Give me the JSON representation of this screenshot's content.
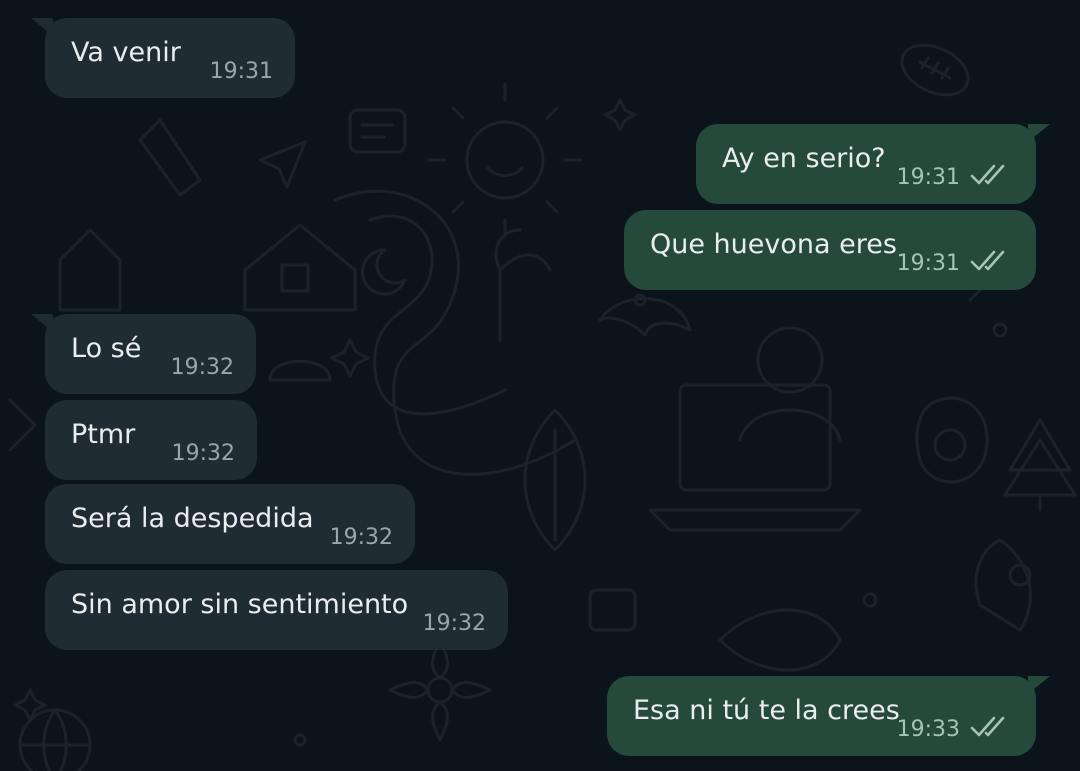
{
  "chat": {
    "messages": [
      {
        "direction": "in",
        "text": "Va venir",
        "time": "19:31",
        "status": "none"
      },
      {
        "direction": "out",
        "text": "Ay en serio?",
        "time": "19:31",
        "status": "read-double-check-icon"
      },
      {
        "direction": "out",
        "text": "Que huevona eres",
        "time": "19:31",
        "status": "read-double-check-icon"
      },
      {
        "direction": "in",
        "text": "Lo sé",
        "time": "19:32",
        "status": "none"
      },
      {
        "direction": "in",
        "text": "Ptmr",
        "time": "19:32",
        "status": "none"
      },
      {
        "direction": "in",
        "text": "Será la despedida",
        "time": "19:32",
        "status": "none"
      },
      {
        "direction": "in",
        "text": "Sin amor sin sentimiento",
        "time": "19:32",
        "status": "none"
      },
      {
        "direction": "out",
        "text": "Esa ni tú te la crees",
        "time": "19:33",
        "status": "read-double-check-icon"
      }
    ]
  },
  "colors": {
    "background": "#0b141a",
    "incoming_bubble": "#202c33",
    "outgoing_bubble": "#25493a",
    "text": "#e9edef",
    "timestamp": "#9aa6ad"
  }
}
